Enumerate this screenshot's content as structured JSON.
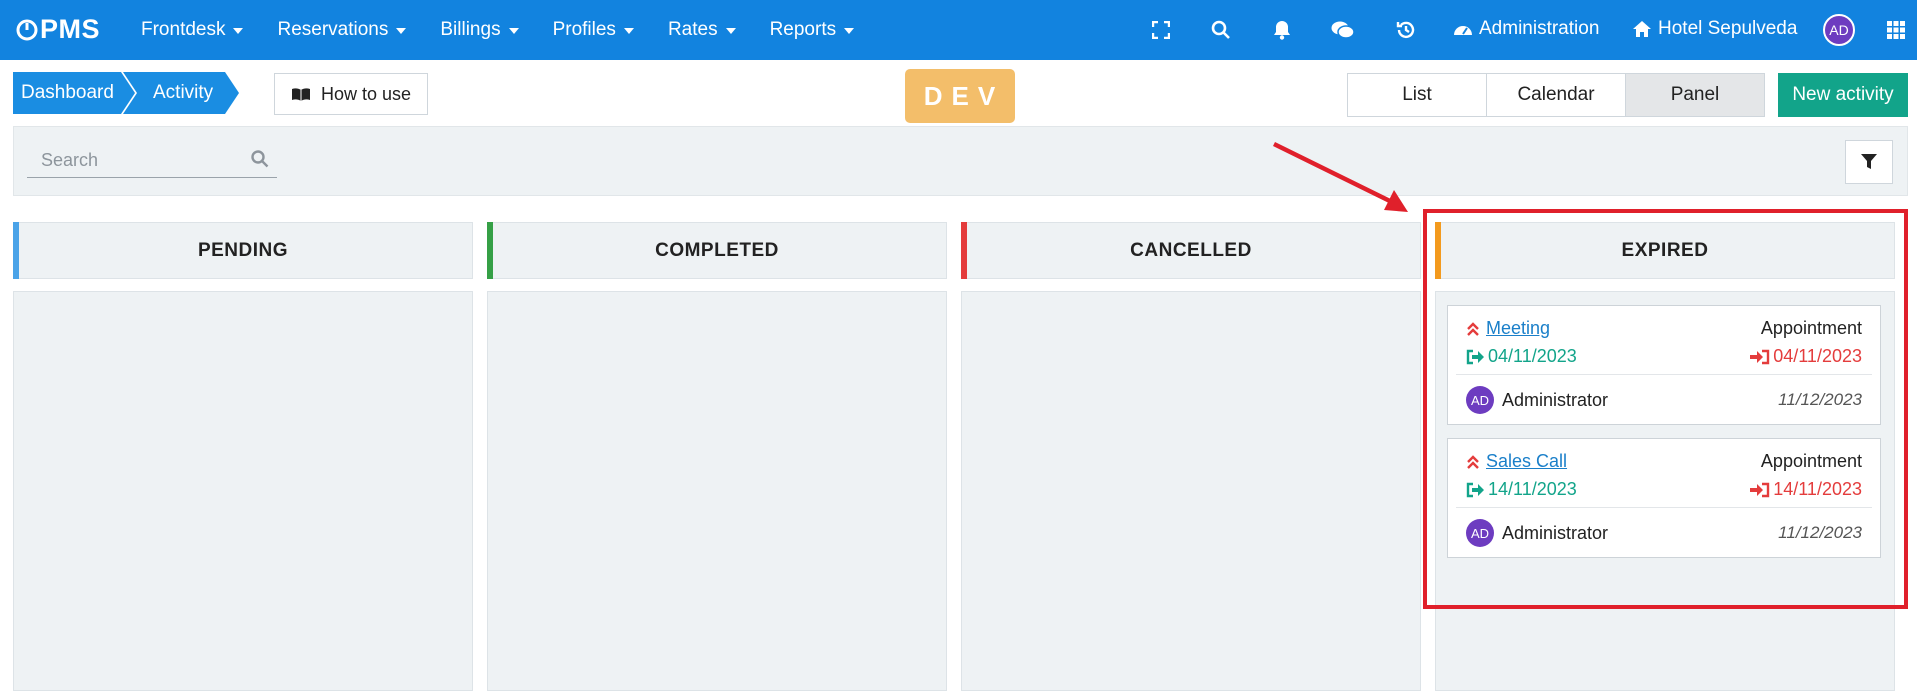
{
  "navbar": {
    "logo": "PMS",
    "menu": [
      {
        "label": "Frontdesk"
      },
      {
        "label": "Reservations"
      },
      {
        "label": "Billings"
      },
      {
        "label": "Profiles"
      },
      {
        "label": "Rates"
      },
      {
        "label": "Reports"
      }
    ],
    "administration": "Administration",
    "hotel": "Hotel Sepulveda",
    "user_initials": "AD",
    "icons": [
      "fullscreen-icon",
      "search-icon",
      "bell-icon",
      "chat-icon",
      "history-icon",
      "dashboard-icon",
      "home-icon",
      "apps-grid-icon"
    ]
  },
  "breadcrumb": {
    "items": [
      "Dashboard",
      "Activity"
    ]
  },
  "how_to_use": "How to use",
  "env_badge": "DEV",
  "views": [
    {
      "label": "List",
      "active": false
    },
    {
      "label": "Calendar",
      "active": false
    },
    {
      "label": "Panel",
      "active": true
    }
  ],
  "new_activity": "New activity",
  "search": {
    "placeholder": "Search"
  },
  "columns": [
    {
      "title": "PENDING",
      "color": "#4aa3e8"
    },
    {
      "title": "COMPLETED",
      "color": "#35a046"
    },
    {
      "title": "CANCELLED",
      "color": "#e43c3c"
    },
    {
      "title": "EXPIRED",
      "color": "#f39a1e"
    }
  ],
  "expired_cards": [
    {
      "title": "Meeting",
      "type": "Appointment",
      "start": "04/11/2023",
      "end": "04/11/2023",
      "user_initials": "AD",
      "user": "Administrator",
      "date": "11/12/2023"
    },
    {
      "title": "Sales Call",
      "type": "Appointment",
      "start": "14/11/2023",
      "end": "14/11/2023",
      "user_initials": "AD",
      "user": "Administrator",
      "date": "11/12/2023"
    }
  ],
  "colors": {
    "navbar": "#1283df",
    "accent_green": "#12a48a",
    "highlight_red": "#e0202b",
    "dev_badge": "#f3be6a"
  }
}
